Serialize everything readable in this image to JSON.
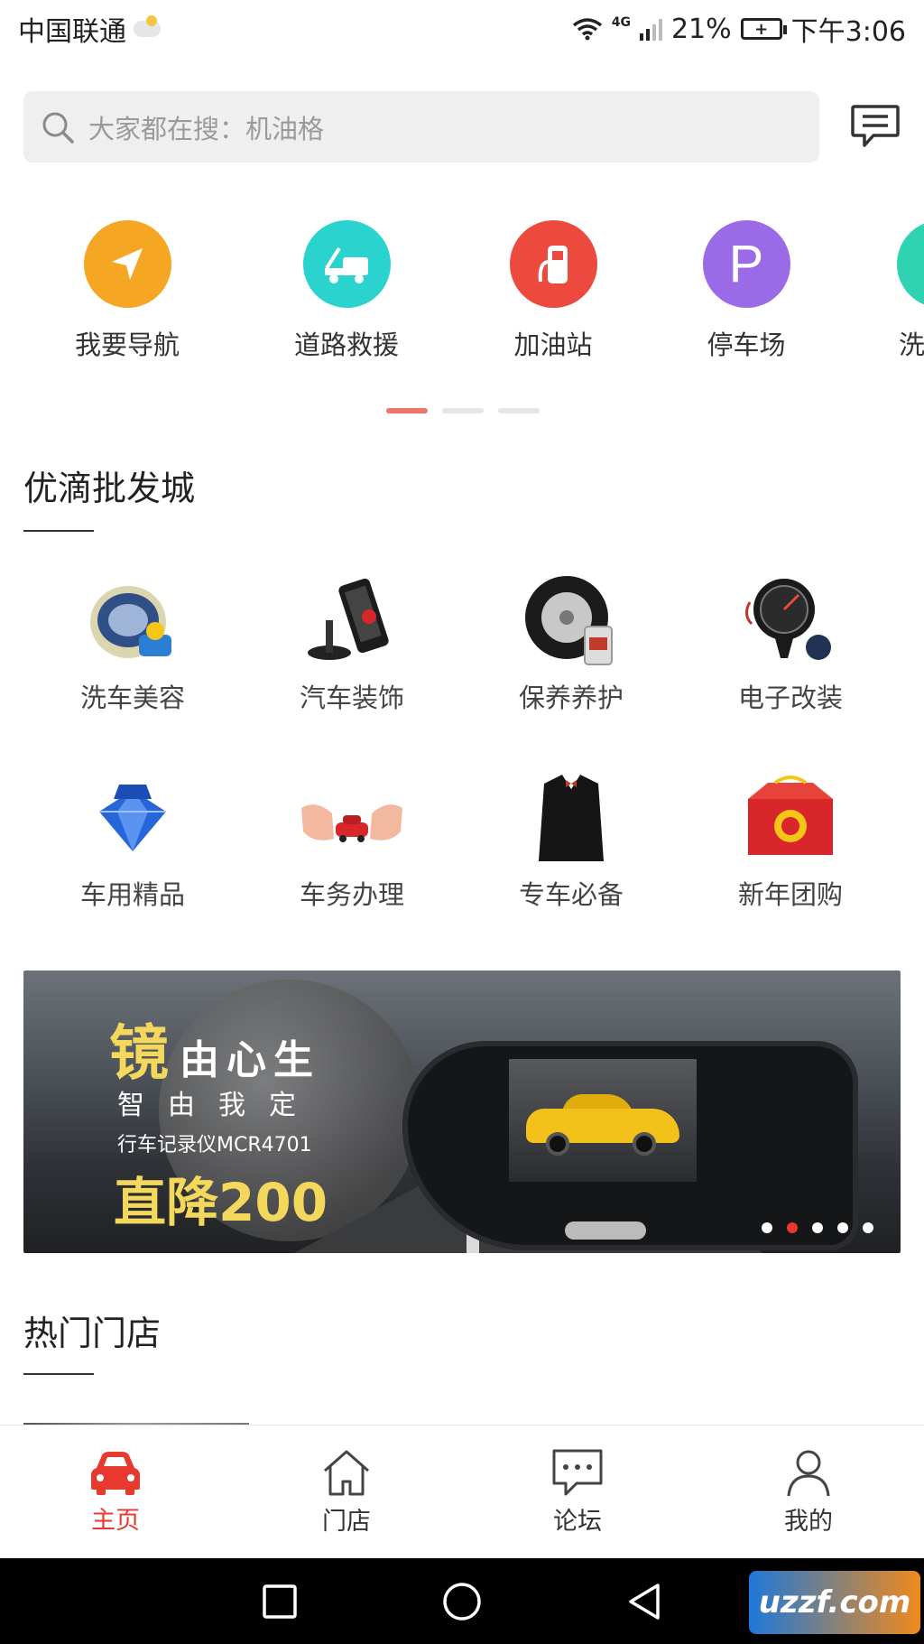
{
  "status_bar": {
    "carrier": "中国联通",
    "network": "4G",
    "battery_percent": "21%",
    "time": "下午3:06"
  },
  "search": {
    "placeholder": "大家都在搜：机油格"
  },
  "quick_actions": [
    {
      "label": "我要导航",
      "color": "#f5a623",
      "icon": "navigation-arrow-icon"
    },
    {
      "label": "道路救援",
      "color": "#2bd3cf",
      "icon": "tow-truck-icon"
    },
    {
      "label": "加油站",
      "color": "#ec4a3f",
      "icon": "fuel-pump-icon"
    },
    {
      "label": "停车场",
      "color": "#9b6ae6",
      "icon": "parking-icon",
      "glyph": "P"
    },
    {
      "label": "洗",
      "color": "#2fd3b2",
      "icon": "car-wash-icon"
    }
  ],
  "quick_pager": {
    "pages": 3,
    "active": 0
  },
  "wholesale": {
    "title": "优滴批发城",
    "categories": [
      {
        "label": "洗车美容",
        "icon": "car-wax-icon"
      },
      {
        "label": "汽车装饰",
        "icon": "phone-holder-icon"
      },
      {
        "label": "保养养护",
        "icon": "tire-oil-icon"
      },
      {
        "label": "电子改装",
        "icon": "speedometer-icon"
      },
      {
        "label": "车用精品",
        "icon": "crystal-perfume-icon"
      },
      {
        "label": "车务办理",
        "icon": "hands-car-icon"
      },
      {
        "label": "专车必备",
        "icon": "suit-icon"
      },
      {
        "label": "新年团购",
        "icon": "gift-box-icon"
      }
    ]
  },
  "banner": {
    "headline_big": "镜",
    "headline_rest": "由心生",
    "subline": "智由我定",
    "product": "行车记录仪MCR4701",
    "promo": "直降200",
    "dots": 5,
    "active_dot": 1
  },
  "hot_stores": {
    "title": "热门门店"
  },
  "tabbar": [
    {
      "label": "主页",
      "active": true,
      "icon": "car-icon"
    },
    {
      "label": "门店",
      "active": false,
      "icon": "home-icon"
    },
    {
      "label": "论坛",
      "active": false,
      "icon": "chat-bubble-icon"
    },
    {
      "label": "我的",
      "active": false,
      "icon": "user-icon"
    }
  ],
  "watermark": {
    "text": "uzzf.com"
  },
  "colors": {
    "accent": "#e8392f",
    "search_bg": "#efefef"
  }
}
